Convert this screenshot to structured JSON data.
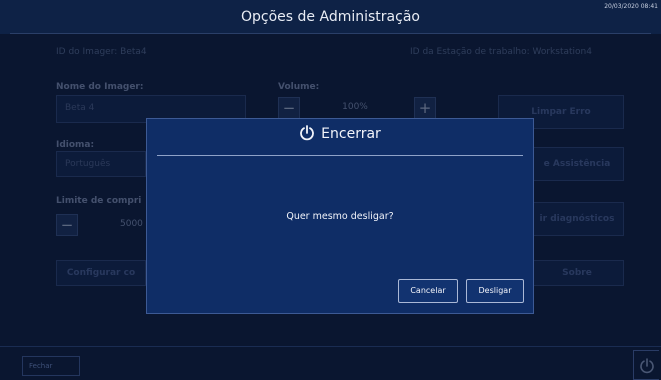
{
  "header": {
    "title": "Opções de Administração",
    "datetime": "20/03/2020 08:41"
  },
  "background": {
    "imager_id": "ID do Imager: Beta4",
    "workstation_id": "ID da Estação de trabalho: Workstation4",
    "imager_name_label": "Nome do Imager:",
    "imager_name_value": "Beta 4",
    "volume_label": "Volume:",
    "volume_value": "100%",
    "language_label": "Idioma:",
    "language_value": "Português",
    "length_label": "Limite de compri",
    "length_value": "5000",
    "configure_button": "Configurar co",
    "clear_button": "Limpar Erro",
    "assist_button": "e Assistência",
    "diag_button": "ir diagnósticos",
    "about_button": "Sobre",
    "close_button": "Fechar"
  },
  "dialog": {
    "title": "Encerrar",
    "message": "Quer mesmo desligar?",
    "cancel_label": "Cancelar",
    "confirm_label": "Desligar"
  }
}
